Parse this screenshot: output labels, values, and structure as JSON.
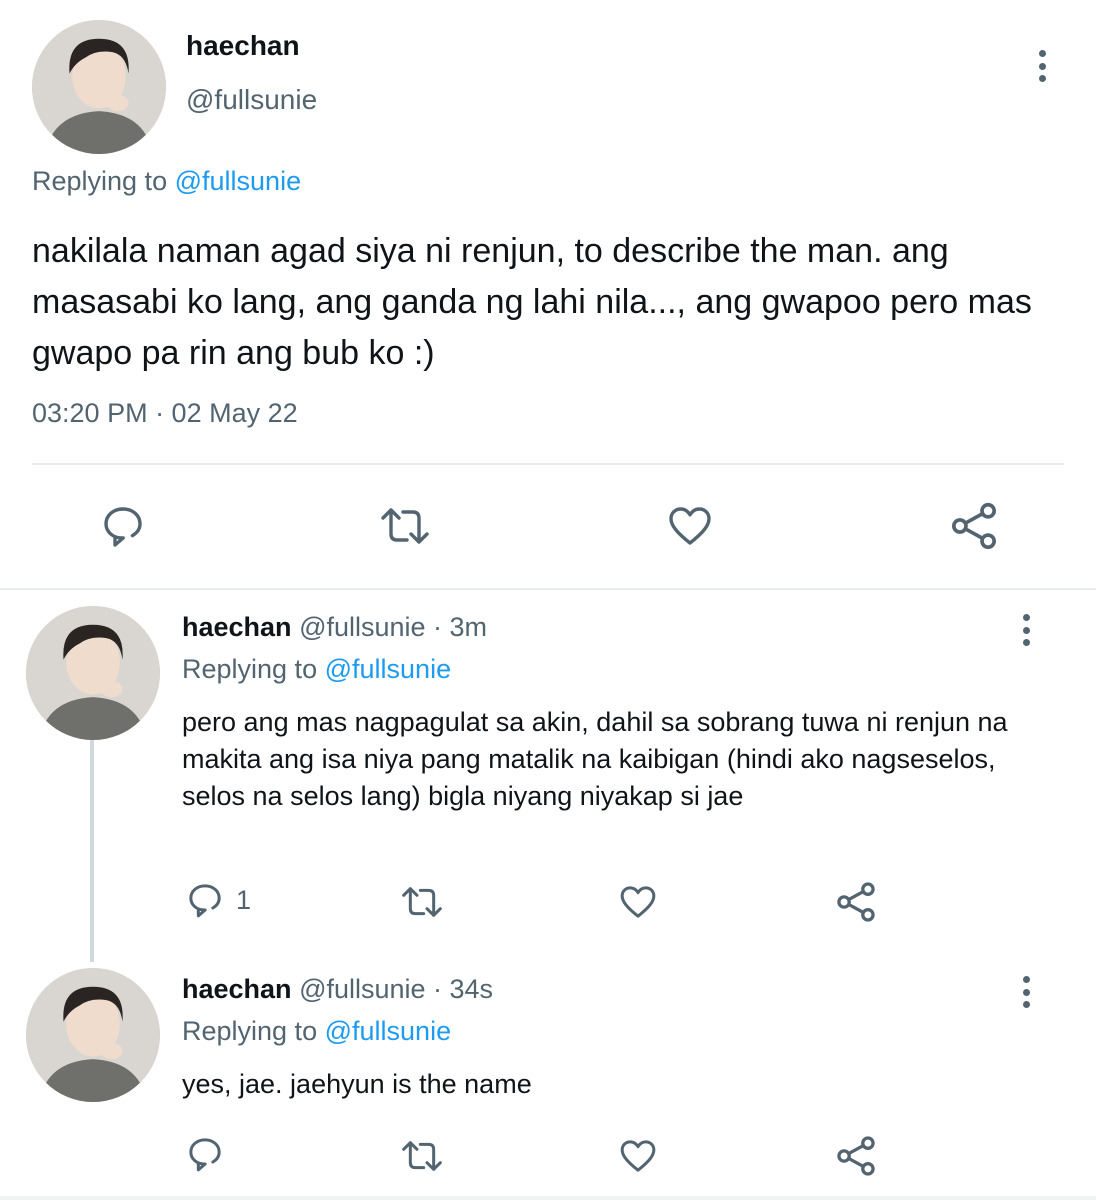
{
  "main_tweet": {
    "name": "haechan",
    "handle": "@fullsunie",
    "replying_prefix": "Replying to",
    "replying_handle": "@fullsunie",
    "text": "nakilala naman agad siya ni renjun, to describe the man. ang masasabi ko lang, ang ganda ng lahi nila..., ang gwapoo pero mas gwapo pa rin ang bub ko :)",
    "timestamp": "03:20 PM · 02 May 22",
    "actions": [
      "reply-icon",
      "retweet-icon",
      "like-icon",
      "share-icon"
    ]
  },
  "replies": [
    {
      "name": "haechan",
      "meta": "@fullsunie · 3m",
      "replying_prefix": "Replying to",
      "replying_handle": "@fullsunie",
      "text": "pero ang mas nagpagulat sa akin, dahil sa sobrang tuwa ni renjun na makita ang isa niya pang matalik na kaibigan (hindi ako nagseselos, selos na selos lang) bigla niyang niyakap si jae",
      "reply_count": "1"
    },
    {
      "name": "haechan",
      "meta": "@fullsunie · 34s",
      "replying_prefix": "Replying to",
      "replying_handle": "@fullsunie",
      "text": "yes, jae. jaehyun is the name",
      "reply_count": ""
    }
  ],
  "colors": {
    "link": "#1d9bf0",
    "secondary_text": "#536471",
    "primary_text": "#0f1419",
    "divider": "#e6ecf0"
  }
}
